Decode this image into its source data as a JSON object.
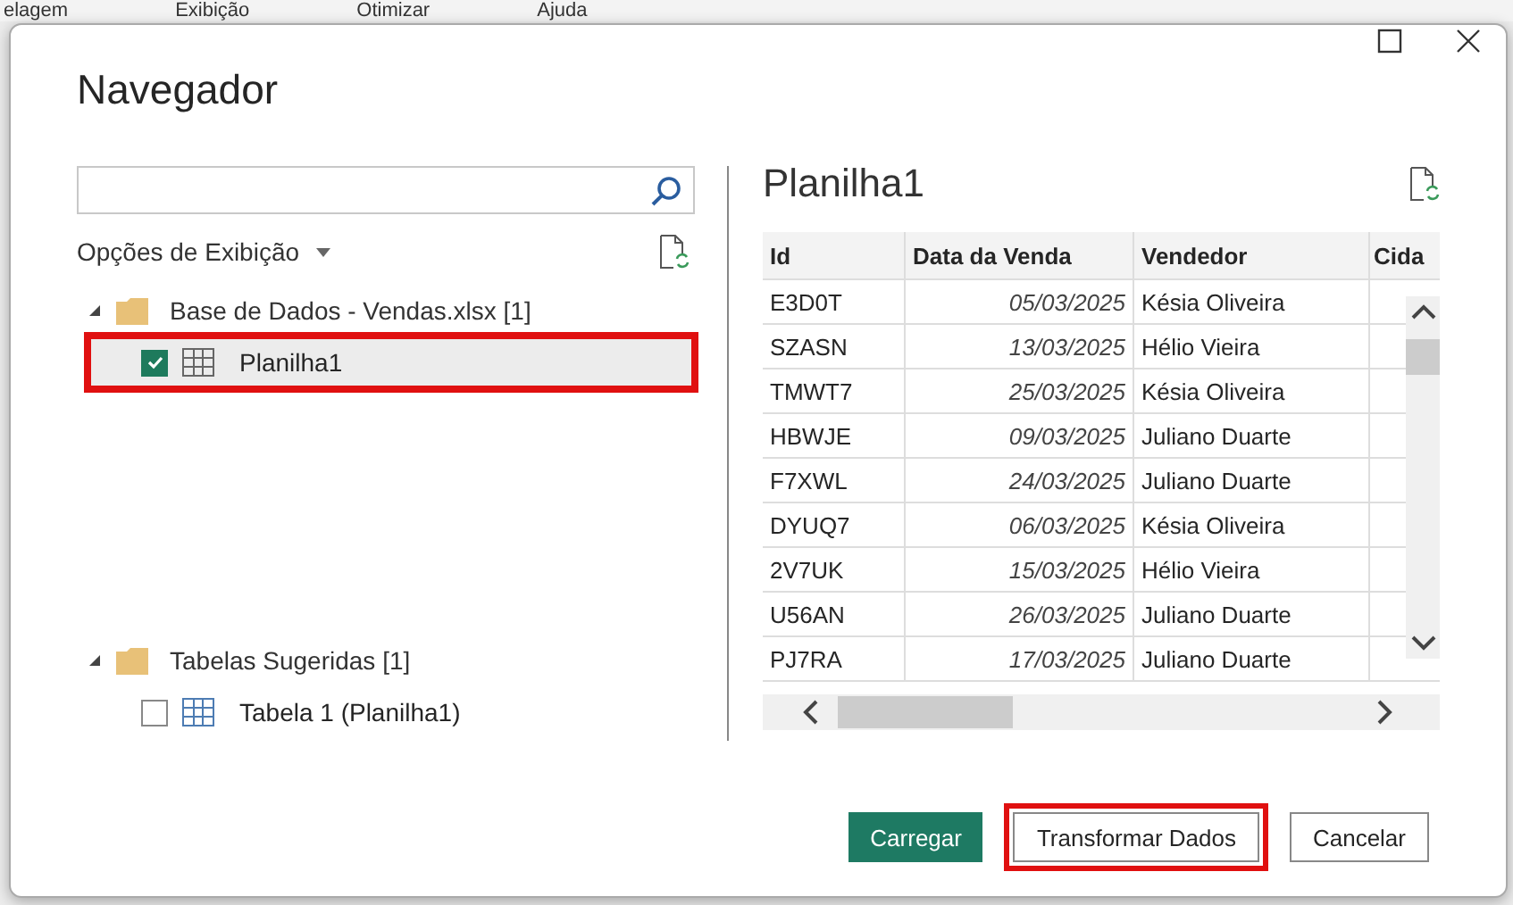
{
  "background_menu": [
    "elagem",
    "Exibição",
    "Otimizar",
    "Ajuda"
  ],
  "window": {
    "title": "Navegador"
  },
  "display_options": {
    "label": "Opções de Exibição"
  },
  "tree": [
    {
      "label": "Base de Dados - Vendas.xlsx [1]",
      "expanded": true,
      "children": [
        {
          "label": "Planilha1",
          "checked": true,
          "selected": true,
          "highlighted": true
        }
      ]
    },
    {
      "label": "Tabelas Sugeridas [1]",
      "expanded": true,
      "children": [
        {
          "label": "Tabela 1 (Planilha1)",
          "checked": false,
          "selected": false,
          "highlighted": false
        }
      ]
    }
  ],
  "preview": {
    "title": "Planilha1",
    "table": {
      "columns": [
        "Id",
        "Data da Venda",
        "Vendedor",
        "Cida"
      ],
      "rows": [
        [
          "E3D0T",
          "05/03/2025",
          "Késia Oliveira"
        ],
        [
          "SZASN",
          "13/03/2025",
          "Hélio Vieira"
        ],
        [
          "TMWT7",
          "25/03/2025",
          "Késia Oliveira"
        ],
        [
          "HBWJE",
          "09/03/2025",
          "Juliano Duarte"
        ],
        [
          "F7XWL",
          "24/03/2025",
          "Juliano Duarte"
        ],
        [
          "DYUQ7",
          "06/03/2025",
          "Késia Oliveira"
        ],
        [
          "2V7UK",
          "15/03/2025",
          "Hélio Vieira"
        ],
        [
          "U56AN",
          "26/03/2025",
          "Juliano Duarte"
        ],
        [
          "PJ7RA",
          "17/03/2025",
          "Juliano Duarte"
        ]
      ]
    }
  },
  "buttons": [
    {
      "label": "Carregar",
      "kind": "primary",
      "highlighted": false
    },
    {
      "label": "Transformar Dados",
      "kind": "secondary",
      "highlighted": true
    },
    {
      "label": "Cancelar",
      "kind": "secondary",
      "highlighted": false
    }
  ]
}
